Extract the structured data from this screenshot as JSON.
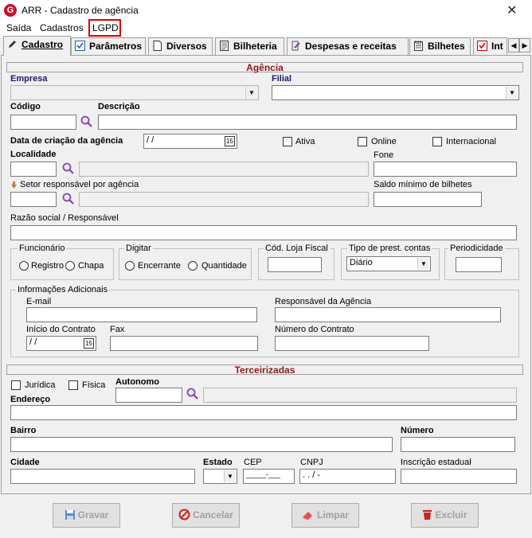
{
  "window": {
    "title": "ARR - Cadastro de agência",
    "icon": "G",
    "close": "✕"
  },
  "menu": [
    "Saída",
    "Cadastros",
    "LGPD"
  ],
  "tabs": [
    "Cadastro",
    "Parâmetros",
    "Diversos",
    "Bilheteria",
    "Despesas e receitas",
    "Bilhetes",
    "Int"
  ],
  "agencia": {
    "header": "Agência",
    "empresa_label": "Empresa",
    "filial_label": "Filial",
    "codigo_label": "Código",
    "descricao_label": "Descrição",
    "data_criacao_label": "Data de criação da agência",
    "data_criacao_value": "/ /",
    "ativa_label": "Ativa",
    "online_label": "Online",
    "internacional_label": "Internacional",
    "localidade_label": "Localidade",
    "fone_label": "Fone",
    "setor_label": "Setor responsável por agência",
    "saldo_label": "Saldo mínimo de bilhetes",
    "razao_label": "Razão social / Responsável",
    "funcionario_title": "Funcionário",
    "registro_label": "Registro",
    "chapa_label": "Chapa",
    "digitar_title": "Digitar",
    "encerrante_label": "Encerrante",
    "quantidade_label": "Quantidade",
    "loja_fiscal_label": "Cód. Loja Fiscal",
    "tipo_prest_label": "Tipo de prest. contas",
    "tipo_prest_value": "Diário",
    "periodicidade_label": "Periodicidade",
    "info_title": "Informações Adicionais",
    "email_label": "E-mail",
    "resp_agencia_label": "Responsável da Agência",
    "inicio_contrato_label": "Início do Contrato",
    "inicio_contrato_value": "/ /",
    "fax_label": "Fax",
    "numero_contrato_label": "Número do Contrato"
  },
  "terceirizadas": {
    "header": "Terceirizadas",
    "juridica_label": "Jurídica",
    "fisica_label": "Física",
    "autonomo_label": "Autonomo",
    "endereco_label": "Endereço",
    "bairro_label": "Bairro",
    "numero_label": "Número",
    "cidade_label": "Cidade",
    "estado_label": "Estado",
    "cep_label": "CEP",
    "cep_value": "_____-___",
    "cnpj_label": "CNPJ",
    "cnpj_value": ".   .   /   -",
    "ie_label": "Inscrição estadual"
  },
  "buttons": {
    "gravar": "Gravar",
    "cancelar": "Cancelar",
    "limpar": "Limpar",
    "excluir": "Excluir"
  },
  "icons": {
    "search": "search-icon",
    "calendar": "calendar-icon",
    "dropdown": "chevron-down-icon"
  },
  "colors": {
    "section_header": "#8b1a1a",
    "highlight": "#e00000",
    "accent": "#c8102e"
  }
}
